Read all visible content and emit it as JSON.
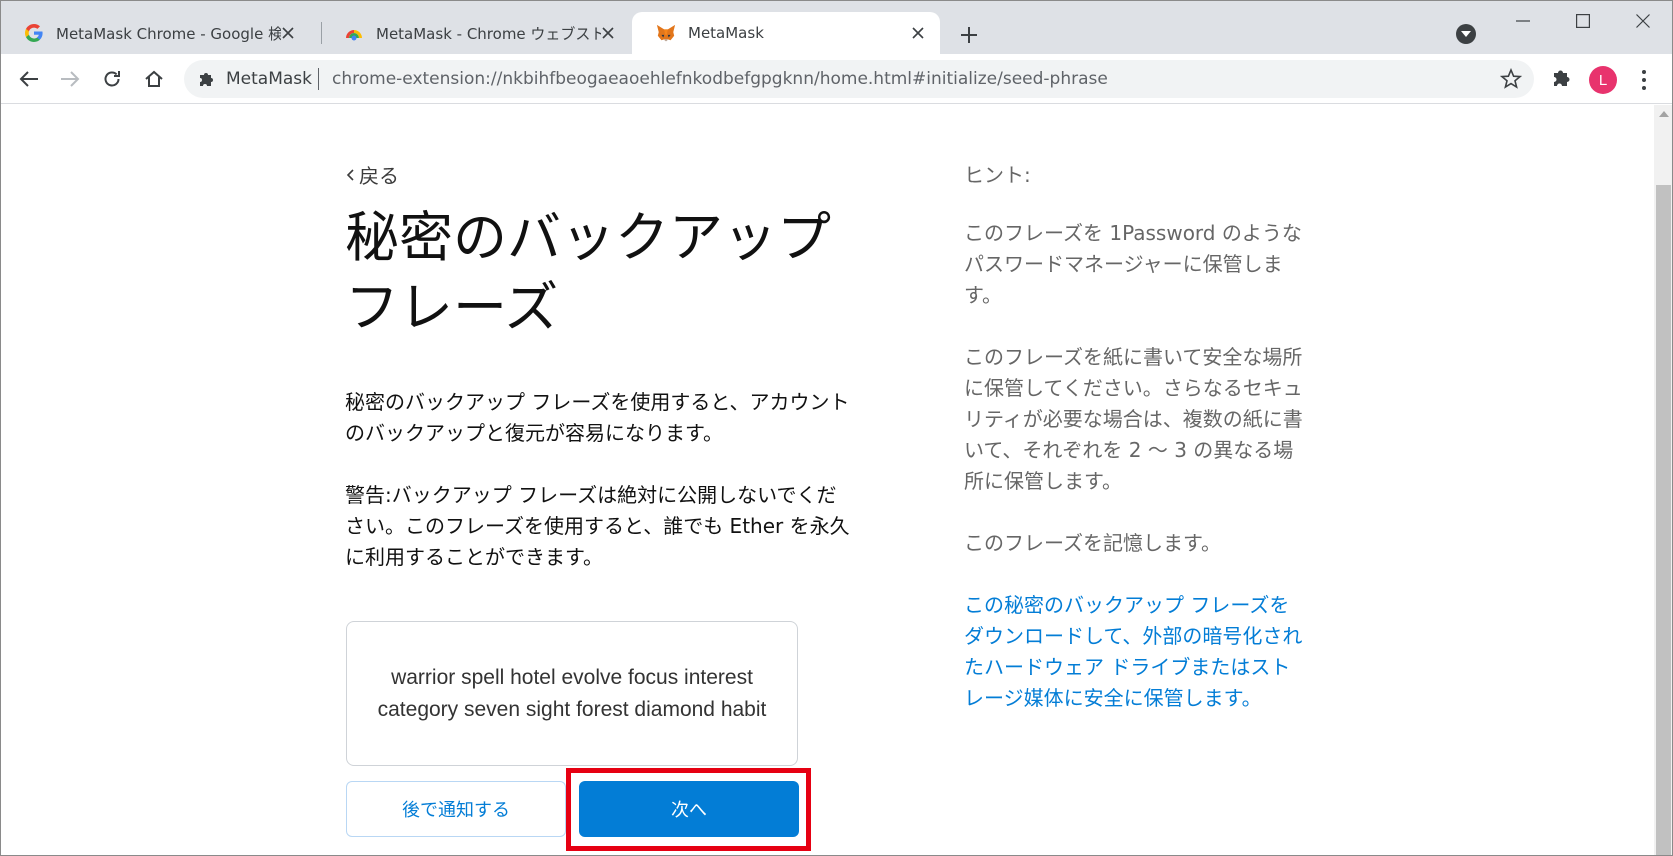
{
  "browser": {
    "tabs": [
      {
        "title": "MetaMask Chrome - Google 検索",
        "icon": "google-g-icon",
        "active": false
      },
      {
        "title": "MetaMask - Chrome ウェブストア",
        "icon": "chrome-web-store-icon",
        "active": false
      },
      {
        "title": "MetaMask",
        "icon": "metamask-fox-icon",
        "active": true
      }
    ],
    "omnibox": {
      "site_name": "MetaMask",
      "url": "chrome-extension://nkbihfbeogaeaoehlefnkodbefgpgknn/home.html#initialize/seed-phrase"
    },
    "avatar_letter": "L"
  },
  "page": {
    "back_label": "戻る",
    "title_line1": "秘密のバックアップ",
    "title_line2": "フレーズ",
    "description": "秘密のバックアップ フレーズを使用すると、アカウントのバックアップと復元が容易になります。",
    "warning": "警告:バックアップ フレーズは絶対に公開しないでください。このフレーズを使用すると、誰でも Ether を永久に利用することができます。",
    "seed_phrase": "warrior spell hotel evolve focus interest category seven sight forest diamond habit",
    "remind_later_label": "後で通知する",
    "next_label": "次へ"
  },
  "hints": {
    "title": "ヒント:",
    "hint1": "このフレーズを 1Password のようなパスワードマネージャーに保管します。",
    "hint2": "このフレーズを紙に書いて安全な場所に保管してください。さらなるセキュリティが必要な場合は、複数の紙に書いて、それぞれを 2 ～ 3 の異なる場所に保管します。",
    "hint3": "このフレーズを記憶します。",
    "download_link": "この秘密のバックアップ フレーズをダウンロードして、外部の暗号化されたハードウェア ドライブまたはストレージ媒体に安全に保管します。"
  },
  "colors": {
    "accent": "#037dd6",
    "highlight": "#e60012",
    "avatar": "#e8336d"
  }
}
